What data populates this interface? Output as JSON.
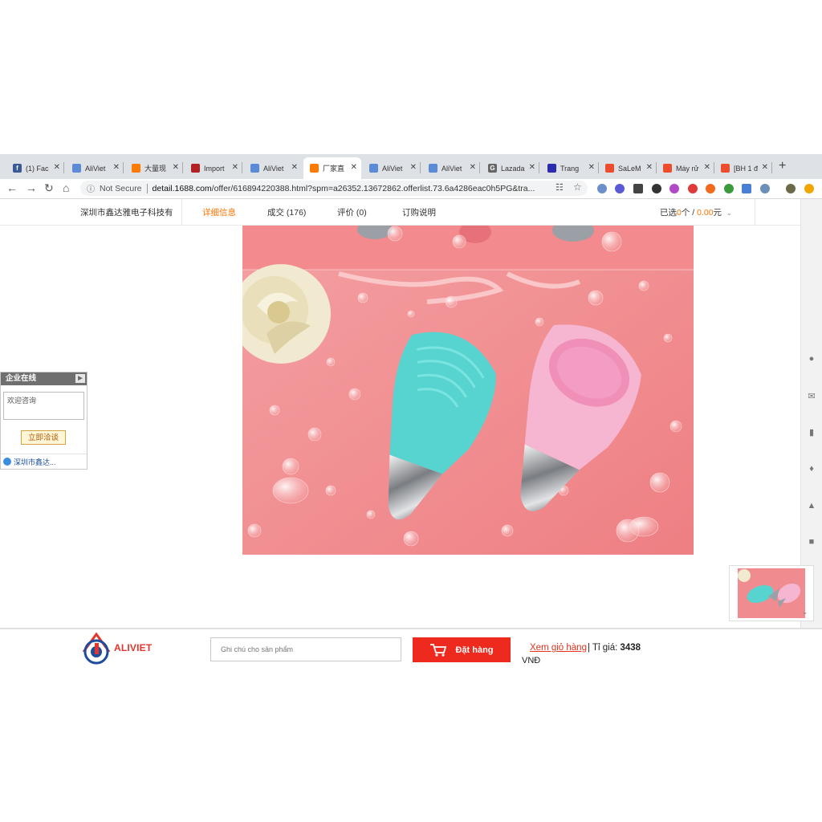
{
  "browser": {
    "tabs": [
      {
        "label": "(1) Fac",
        "favicon_color": "#3b5998",
        "favicon_text": "f"
      },
      {
        "label": "AliViet",
        "favicon_color": "#5b8bd6",
        "favicon_text": ""
      },
      {
        "label": "大量现",
        "favicon_color": "#ff7a00",
        "favicon_text": ""
      },
      {
        "label": "Import",
        "favicon_color": "#b22222",
        "favicon_text": ""
      },
      {
        "label": "AliViet",
        "favicon_color": "#5b8bd6",
        "favicon_text": ""
      },
      {
        "label": "厂家直",
        "favicon_color": "#ff7a00",
        "favicon_text": ""
      },
      {
        "label": "AliViet",
        "favicon_color": "#5b8bd6",
        "favicon_text": ""
      },
      {
        "label": "AliViet",
        "favicon_color": "#5b8bd6",
        "favicon_text": ""
      },
      {
        "label": "Lazada",
        "favicon_color": "#666666",
        "favicon_text": "G"
      },
      {
        "label": "Trang",
        "favicon_color": "#2b2bb0",
        "favicon_text": ""
      },
      {
        "label": "SaLeM",
        "favicon_color": "#ee4d2d",
        "favicon_text": ""
      },
      {
        "label": "Máy rử",
        "favicon_color": "#ee4d2d",
        "favicon_text": ""
      },
      {
        "label": "[BH 1 đ",
        "favicon_color": "#ee4d2d",
        "favicon_text": ""
      }
    ],
    "new_tab_label": "+",
    "security_label": "Not Secure",
    "url_domain": "detail.1688.com",
    "url_path": "/offer/616894220388.html?spm=a26352.13672862.offerlist.73.6a4286eac0h5PG&tra..."
  },
  "page_nav": {
    "shop_name": "深圳市鑫达雅电子科技有",
    "tabs": [
      "详细信息",
      "成交 (176)",
      "评价 (0)",
      "订购说明"
    ],
    "selected_prefix": "已选",
    "selected_count": "0",
    "selected_unit": "个 / ",
    "selected_amount": "0.00",
    "selected_currency": "元",
    "dropdown_icon": "chevron-down-icon"
  },
  "service_widget": {
    "title": "企业在线",
    "message_placeholder": "欢迎咨询",
    "chat_button": "立即洽谈",
    "company_link": "深圳市鑫达..."
  },
  "bottom_bar": {
    "logo_text": "ALIVIET",
    "note_placeholder": "Ghi chú cho sản phẩm",
    "order_button": "Đặt hàng",
    "cart_link": "Xem giỏ hàng",
    "rate_label": "| Tỉ giá:",
    "rate_value": "3438",
    "currency": "VNĐ"
  },
  "colors": {
    "accent_orange": "#ff7300",
    "order_red": "#ee2a1e",
    "product_bg_pink": "#f08b8f"
  }
}
